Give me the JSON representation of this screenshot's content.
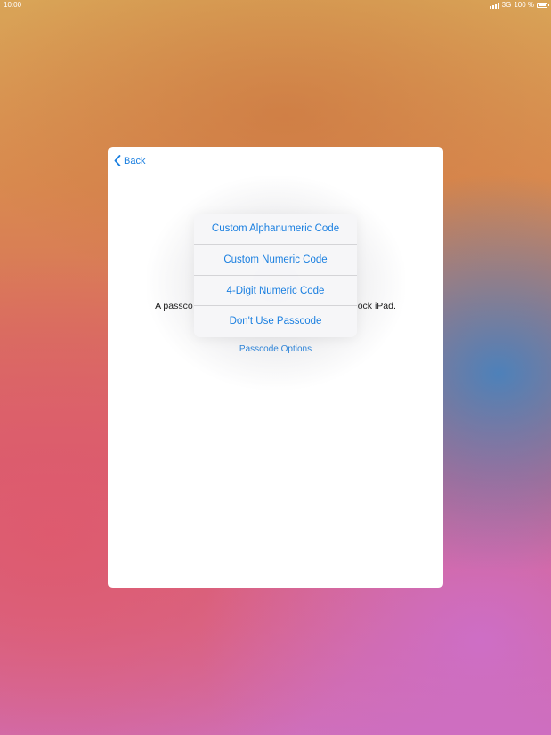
{
  "status_bar": {
    "time": "10:00",
    "network": "3G",
    "battery": "100 %"
  },
  "sheet": {
    "back_label": "Back",
    "description_left": "A passco",
    "description_right": "ock iPad.",
    "passcode_options_label": "Passcode Options"
  },
  "menu": {
    "items": [
      {
        "label": "Custom Alphanumeric Code"
      },
      {
        "label": "Custom Numeric Code"
      },
      {
        "label": "4-Digit Numeric Code"
      },
      {
        "label": "Don't Use Passcode"
      }
    ]
  },
  "colors": {
    "accent": "#1a7fe0",
    "sheet_background": "#ffffff",
    "menu_background": "#f6f6f8"
  }
}
